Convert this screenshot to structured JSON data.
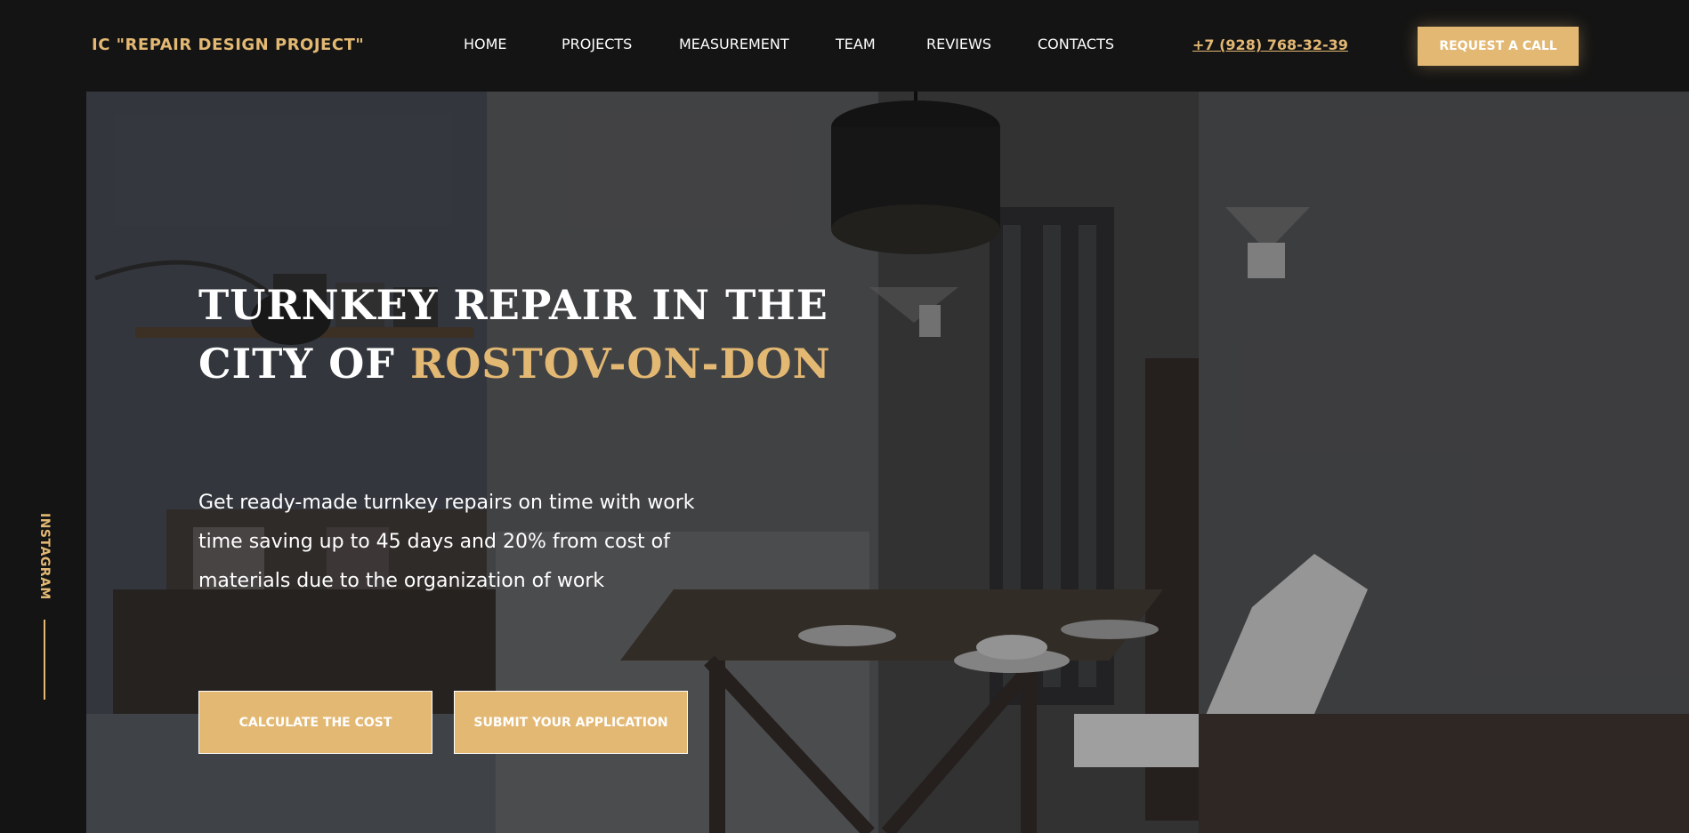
{
  "header": {
    "logo": "IC \"REPAIR DESIGN PROJECT\"",
    "nav": [
      "HOME",
      "PROJECTS",
      "MEASUREMENT",
      "TEAM",
      "REVIEWS",
      "CONTACTS"
    ],
    "phone": "+7 (928) 768-32-39",
    "request_button": "REQUEST A CALL"
  },
  "hero": {
    "title_line1": "TURNKEY REPAIR IN THE",
    "title_line2_prefix": "CITY OF ",
    "title_line2_accent": "ROSTOV-ON-DON",
    "subtitle": "Get ready-made turnkey repairs on time with work time saving up to 45 days and 20% from cost of materials due to the organization of work",
    "buttons": {
      "calculate": "CALCULATE THE COST",
      "submit": "SUBMIT YOUR APPLICATION"
    }
  },
  "side": {
    "instagram": "INSTAGRAM"
  },
  "colors": {
    "accent": "#e3b873",
    "background": "#141414"
  }
}
